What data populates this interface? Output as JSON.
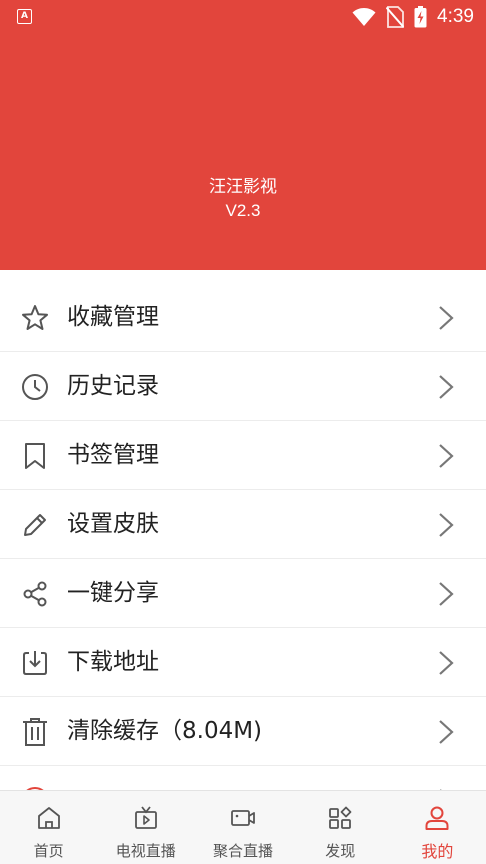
{
  "status_bar": {
    "time": "4:39",
    "app_icon_glyph": "A"
  },
  "header": {
    "app_name": "汪汪影视",
    "version": "V2.3",
    "color": "#e2453c"
  },
  "menu": {
    "items": [
      {
        "label": "收藏管理",
        "icon": "star-icon"
      },
      {
        "label": "历史记录",
        "icon": "clock-icon"
      },
      {
        "label": "书签管理",
        "icon": "bookmark-icon"
      },
      {
        "label": "设置皮肤",
        "icon": "pencil-icon"
      },
      {
        "label": "一键分享",
        "icon": "share-icon"
      },
      {
        "label": "下载地址",
        "icon": "download-icon"
      },
      {
        "label": "清除缓存（8.04M)",
        "icon": "trash-icon"
      },
      {
        "label": "",
        "icon": "partial-icon"
      }
    ]
  },
  "tabbar": {
    "tabs": [
      {
        "label": "首页",
        "icon": "home-icon",
        "active": false
      },
      {
        "label": "电视直播",
        "icon": "tv-icon",
        "active": false
      },
      {
        "label": "聚合直播",
        "icon": "video-camera-icon",
        "active": false
      },
      {
        "label": "发现",
        "icon": "grid-icon",
        "active": false
      },
      {
        "label": "我的",
        "icon": "user-icon",
        "active": true
      }
    ],
    "active_color": "#e2453c"
  }
}
